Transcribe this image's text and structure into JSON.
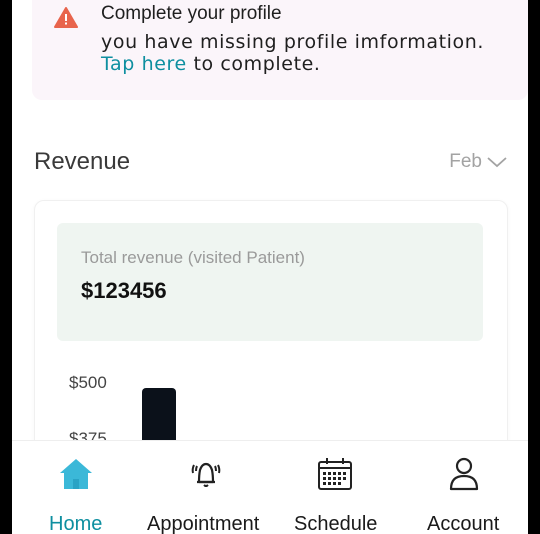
{
  "banner": {
    "title": "Complete your profile",
    "line1": "you have missing profile imformation.",
    "link": "Tap here",
    "line2_rest": " to complete.",
    "warning_icon": "warning-triangle-icon",
    "warning_color": "#e8644c"
  },
  "revenue": {
    "title": "Revenue",
    "month": "Feb",
    "total_label": "Total revenue (visited Patient)",
    "total_value": "$123456",
    "axis_labels": [
      "$500",
      "$375"
    ]
  },
  "nav": {
    "items": [
      {
        "label": "Home",
        "icon": "home-icon",
        "active": true
      },
      {
        "label": "Appointment",
        "icon": "bell-ringing-icon",
        "active": false
      },
      {
        "label": "Schedule",
        "icon": "calendar-icon",
        "active": false
      },
      {
        "label": "Account",
        "icon": "user-icon",
        "active": false
      }
    ]
  },
  "colors": {
    "accent": "#0e8fa0",
    "home_icon": "#3bb8d8",
    "bar": "#0b111a"
  }
}
